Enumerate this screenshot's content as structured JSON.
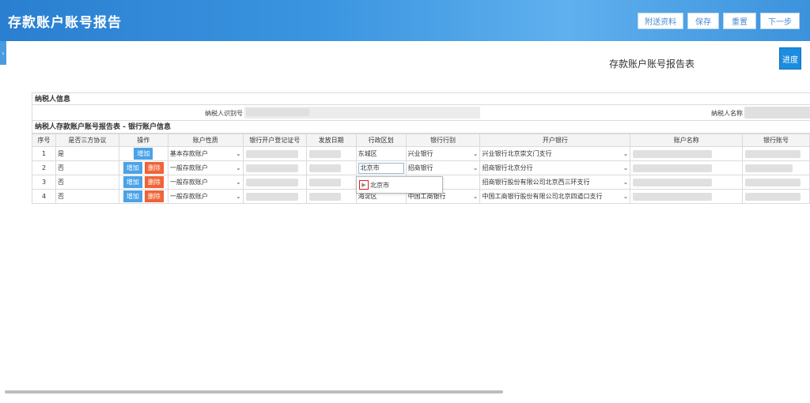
{
  "header": {
    "title": "存款账户账号报告",
    "buttons": {
      "attach": "附送资料",
      "save": "保存",
      "reset": "重置",
      "next": "下一步"
    }
  },
  "side_tab": "›",
  "report_title": "存款账户账号报告表",
  "progress_label": "进度",
  "taxpayer": {
    "section_label": "纳税人信息",
    "id_label": "纳税人识别号",
    "name_label": "纳税人名称"
  },
  "accounts": {
    "section_label": "纳税人存款账户账号报告表 - 银行账户信息",
    "columns": [
      "序号",
      "是否三方协议",
      "操作",
      "账户性质",
      "银行开户登记证号",
      "发放日期",
      "行政区划",
      "银行行别",
      "开户银行",
      "账户名称",
      "银行账号"
    ],
    "add_label": "增加",
    "delete_label": "删除",
    "rows": [
      {
        "no": "1",
        "tripartite": "是",
        "nature": "基本存款账户",
        "district": "东城区",
        "bank_type": "兴业银行",
        "branch": "兴业银行北京崇文门支行"
      },
      {
        "no": "2",
        "tripartite": "否",
        "nature": "一般存款账户",
        "district": "北京市",
        "bank_type": "招商银行",
        "branch": "招商银行北京分行"
      },
      {
        "no": "3",
        "tripartite": "否",
        "nature": "一般存款账户",
        "district": "",
        "bank_type": "",
        "branch": "招商银行股份有限公司北京西三环支行"
      },
      {
        "no": "4",
        "tripartite": "否",
        "nature": "一般存款账户",
        "district": "海淀区",
        "bank_type": "中国工商银行",
        "branch": "中国工商银行股份有限公司北京四道口支行"
      }
    ]
  },
  "district_dropdown": {
    "option": "北京市"
  }
}
